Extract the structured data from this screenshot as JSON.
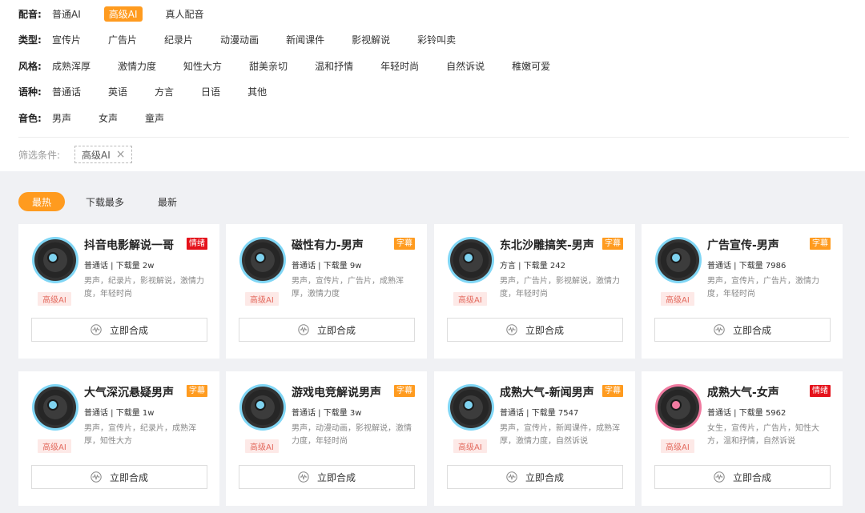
{
  "filters": [
    {
      "label": "配音:",
      "options": [
        "普通AI",
        "高级AI",
        "真人配音"
      ],
      "active": 1
    },
    {
      "label": "类型:",
      "options": [
        "宣传片",
        "广告片",
        "纪录片",
        "动漫动画",
        "新闻课件",
        "影视解说",
        "彩铃叫卖"
      ],
      "active": -1
    },
    {
      "label": "风格:",
      "options": [
        "成熟浑厚",
        "激情力度",
        "知性大方",
        "甜美亲切",
        "温和抒情",
        "年轻时尚",
        "自然诉说",
        "稚嫩可爱"
      ],
      "active": -1
    },
    {
      "label": "语种:",
      "options": [
        "普通话",
        "英语",
        "方言",
        "日语",
        "其他"
      ],
      "active": -1
    },
    {
      "label": "音色:",
      "options": [
        "男声",
        "女声",
        "童声"
      ],
      "active": -1
    }
  ],
  "condition": {
    "label": "筛选条件:",
    "tag": "高级AI",
    "close": "×"
  },
  "sort": {
    "tabs": [
      "最热",
      "下载最多",
      "最新"
    ],
    "active": 0
  },
  "colors": {
    "accent": "#ff9b1f",
    "badge_red": "#e5121b",
    "tag_bg": "#fde9e7",
    "disc_blue": "#80d6f5",
    "disc_pink": "#f07aa0"
  },
  "cards": [
    {
      "title": "抖音电影解说一哥",
      "badge": "情绪",
      "badge_color": "red",
      "meta": "普通话 | 下载量 2w",
      "desc": "男声，纪录片，影视解说，激情力度，年轻时尚",
      "tag": "高级AI",
      "button": "立即合成",
      "disc": "blue"
    },
    {
      "title": "磁性有力-男声",
      "badge": "字幕",
      "badge_color": "orange",
      "meta": "普通话 | 下载量 9w",
      "desc": "男声，宣传片，广告片，成熟浑厚，激情力度",
      "tag": "高级AI",
      "button": "立即合成",
      "disc": "blue"
    },
    {
      "title": "东北沙雕搞笑-男声",
      "badge": "字幕",
      "badge_color": "orange",
      "meta": "方言 | 下载量 242",
      "desc": "男声，广告片，影视解说，激情力度，年轻时尚",
      "tag": "高级AI",
      "button": "立即合成",
      "disc": "blue"
    },
    {
      "title": "广告宣传-男声",
      "badge": "字幕",
      "badge_color": "orange",
      "meta": "普通话 | 下载量 7986",
      "desc": "男声，宣传片，广告片，激情力度，年轻时尚",
      "tag": "高级AI",
      "button": "立即合成",
      "disc": "blue"
    },
    {
      "title": "大气深沉悬疑男声",
      "badge": "字幕",
      "badge_color": "orange",
      "meta": "普通话 | 下载量 1w",
      "desc": "男声，宣传片，纪录片，成熟浑厚，知性大方",
      "tag": "高级AI",
      "button": "立即合成",
      "disc": "blue"
    },
    {
      "title": "游戏电竞解说男声",
      "badge": "字幕",
      "badge_color": "orange",
      "meta": "普通话 | 下载量 3w",
      "desc": "男声，动漫动画，影视解说，激情力度，年轻时尚",
      "tag": "高级AI",
      "button": "立即合成",
      "disc": "blue"
    },
    {
      "title": "成熟大气-新闻男声",
      "badge": "字幕",
      "badge_color": "orange",
      "meta": "普通话 | 下载量 7547",
      "desc": "男声，宣传片，新闻课件，成熟浑厚，激情力度，自然诉说",
      "tag": "高级AI",
      "button": "立即合成",
      "disc": "blue"
    },
    {
      "title": "成熟大气-女声",
      "badge": "情绪",
      "badge_color": "red",
      "meta": "普通话 | 下载量 5962",
      "desc": "女生，宣传片，广告片，知性大方，温和抒情，自然诉说",
      "tag": "高级AI",
      "button": "立即合成",
      "disc": "pink"
    }
  ]
}
